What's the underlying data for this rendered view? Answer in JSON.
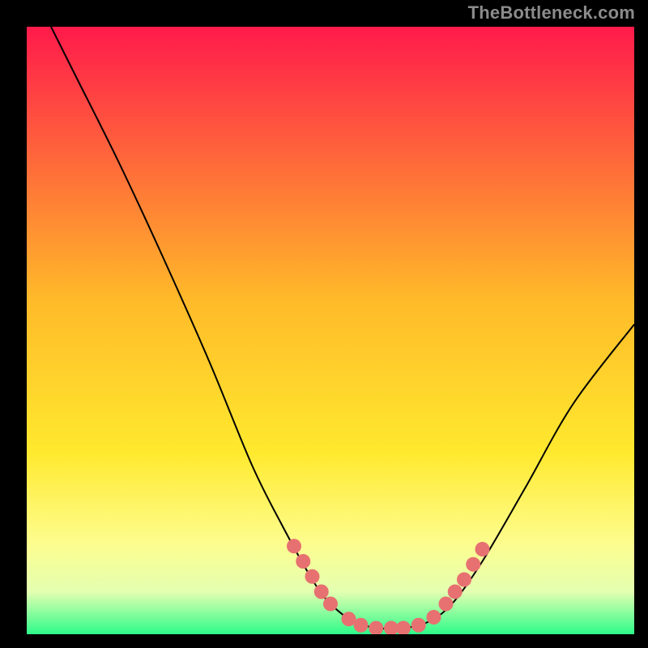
{
  "watermark": "TheBottleneck.com",
  "chart_data": {
    "type": "line",
    "title": "",
    "xlabel": "",
    "ylabel": "",
    "xlim": [
      0,
      100
    ],
    "ylim": [
      0,
      100
    ],
    "background_gradient": {
      "stops": [
        {
          "pct": 0,
          "color": "#ff1a4b"
        },
        {
          "pct": 45,
          "color": "#ffba29"
        },
        {
          "pct": 70,
          "color": "#ffe92e"
        },
        {
          "pct": 85,
          "color": "#fdfd8e"
        },
        {
          "pct": 93,
          "color": "#e4ffb1"
        },
        {
          "pct": 100,
          "color": "#2dfb8a"
        }
      ]
    },
    "series": [
      {
        "name": "bottleneck-curve",
        "color": "#000000",
        "points": [
          {
            "x": 4,
            "y": 100
          },
          {
            "x": 8,
            "y": 92
          },
          {
            "x": 15,
            "y": 78
          },
          {
            "x": 22,
            "y": 63
          },
          {
            "x": 30,
            "y": 45
          },
          {
            "x": 37,
            "y": 28
          },
          {
            "x": 42,
            "y": 18
          },
          {
            "x": 47,
            "y": 9
          },
          {
            "x": 50,
            "y": 5
          },
          {
            "x": 54,
            "y": 2
          },
          {
            "x": 58,
            "y": 1
          },
          {
            "x": 62,
            "y": 1
          },
          {
            "x": 66,
            "y": 2
          },
          {
            "x": 70,
            "y": 5
          },
          {
            "x": 75,
            "y": 12
          },
          {
            "x": 82,
            "y": 24
          },
          {
            "x": 90,
            "y": 38
          },
          {
            "x": 100,
            "y": 51
          }
        ]
      }
    ],
    "markers": {
      "color": "#e77171",
      "radius_pct": 1.2,
      "points": [
        {
          "x": 44.0,
          "y": 14.5
        },
        {
          "x": 45.5,
          "y": 12.0
        },
        {
          "x": 47.0,
          "y": 9.5
        },
        {
          "x": 48.5,
          "y": 7.0
        },
        {
          "x": 50.0,
          "y": 5.0
        },
        {
          "x": 53.0,
          "y": 2.5
        },
        {
          "x": 55.0,
          "y": 1.5
        },
        {
          "x": 57.5,
          "y": 1.0
        },
        {
          "x": 60.0,
          "y": 1.0
        },
        {
          "x": 62.0,
          "y": 1.0
        },
        {
          "x": 64.5,
          "y": 1.5
        },
        {
          "x": 67.0,
          "y": 2.8
        },
        {
          "x": 69.0,
          "y": 5.0
        },
        {
          "x": 70.5,
          "y": 7.0
        },
        {
          "x": 72.0,
          "y": 9.0
        },
        {
          "x": 73.5,
          "y": 11.5
        },
        {
          "x": 75.0,
          "y": 14.0
        }
      ]
    }
  }
}
